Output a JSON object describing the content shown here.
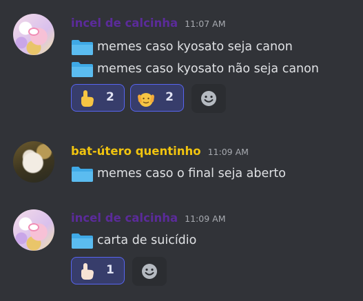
{
  "messages": [
    {
      "author": "incel de calcinha",
      "time": "11:07 AM",
      "lines": [
        "memes caso kyosato seja canon",
        "memes caso kyosato não seja canon"
      ],
      "reactions": [
        {
          "emoji": "pointing-up-hand",
          "count": "2"
        },
        {
          "emoji": "raised-hands-face",
          "count": "2"
        }
      ]
    },
    {
      "author": "bat-útero quentinho",
      "time": "11:09 AM",
      "lines": [
        "memes caso o final seja aberto"
      ]
    },
    {
      "author": "incel de calcinha",
      "time": "11:09 AM",
      "lines": [
        "carta de suicídio"
      ],
      "reactions": [
        {
          "emoji": "pointing-up-hand",
          "count": "1"
        }
      ]
    }
  ],
  "colors": {
    "background": "#313338",
    "username_purple": "#5b2b9a",
    "username_yellow": "#f1c40f",
    "reaction_bg": "#373d6b",
    "reaction_border": "#5865f2",
    "folder": "#3fa9e6"
  }
}
